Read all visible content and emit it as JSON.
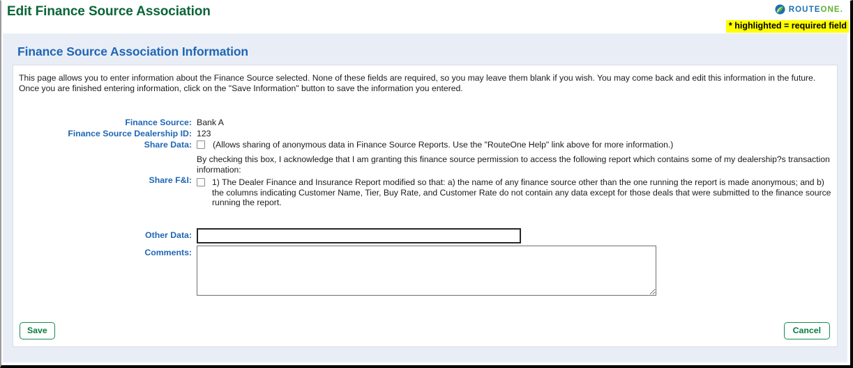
{
  "header": {
    "app_title": "Edit Finance Source Association",
    "brand": {
      "mark_icon": "routeone-leaf-icon",
      "word_primary": "ROUTE",
      "word_secondary": "ONE",
      "trailing_dot": ".",
      "color_primary": "#1b6fb5",
      "color_secondary": "#5eb130"
    },
    "required_note": "* highlighted = required field",
    "required_note_bg": "#ffff00",
    "title_color": "#0a6437"
  },
  "section": {
    "heading": "Finance Source Association Information",
    "heading_color": "#1f66b5",
    "panel_bg": "#e9eef6"
  },
  "intro": {
    "text": "This page allows you to enter information about the Finance Source selected. None of these fields are required, so you may leave them blank if you wish. You may come back and edit this information in the future. Once you are finished entering information, click on the \"Save Information\" button to save the information you entered."
  },
  "form": {
    "finance_source": {
      "label": "Finance Source:",
      "value": "Bank A"
    },
    "dealership_id": {
      "label": "Finance Source Dealership ID:",
      "value": "123"
    },
    "share_data": {
      "label": "Share Data:",
      "checkbox_name": "share-data-checkbox",
      "checked": false,
      "note": "(Allows sharing of anonymous data in Finance Source Reports. Use the \"RouteOne Help\" link above for more information.)"
    },
    "share_fi": {
      "label": "Share F&I:",
      "checkbox_name": "share-fi-checkbox",
      "checked": false,
      "intro": "By checking this box, I acknowledge that I am granting this finance source permission to access the following report which contains some of my dealership?s transaction information:",
      "item": "1) The Dealer Finance and Insurance Report modified so that: a) the name of any finance source other than the one running the report is made anonymous; and b) the columns indicating Customer Name, Tier, Buy Rate, and Customer Rate do not contain any data except for those deals that were submitted to the finance source running the report."
    },
    "other_data": {
      "label": "Other Data:",
      "value": "",
      "placeholder": ""
    },
    "comments": {
      "label": "Comments:",
      "value": "",
      "placeholder": ""
    }
  },
  "footer": {
    "save_label": "Save",
    "cancel_label": "Cancel",
    "button_color": "#0a7b40"
  }
}
